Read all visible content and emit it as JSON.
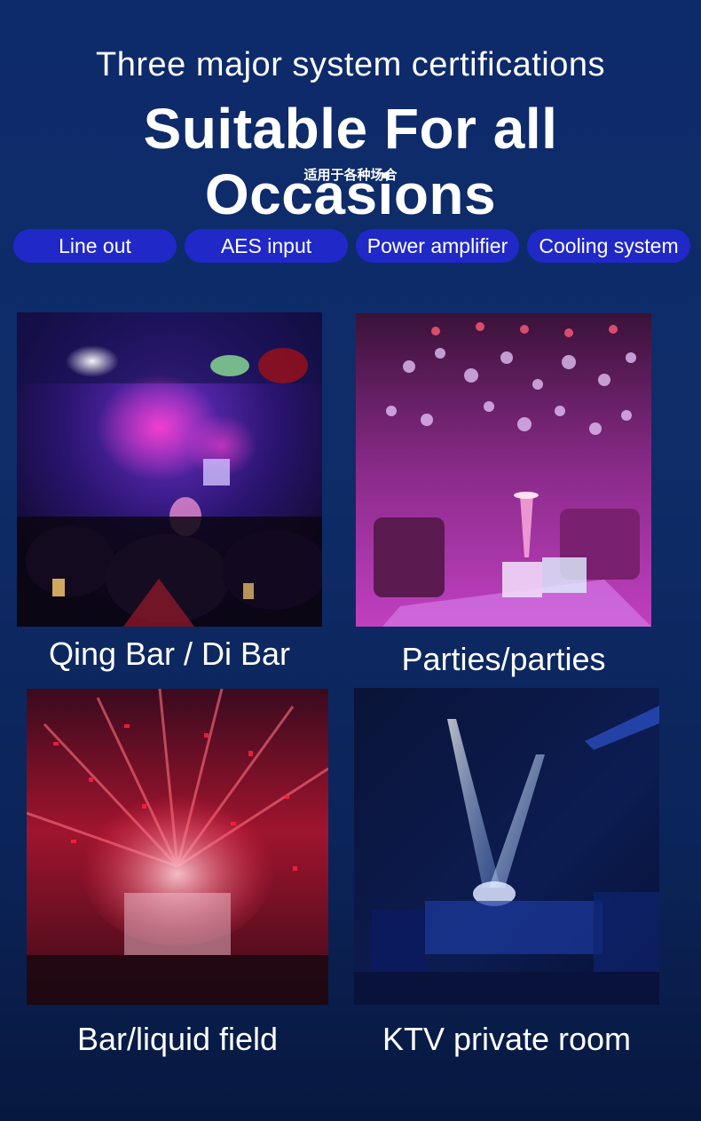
{
  "header": {
    "subtitle": "Three major system certifications",
    "title": "Suitable For all Occasions",
    "chinese_subtitle": "适用于各种场合"
  },
  "features": [
    {
      "label": "Line out"
    },
    {
      "label": "AES input"
    },
    {
      "label": "Power amplifier"
    },
    {
      "label": "Cooling system"
    }
  ],
  "scenes": [
    {
      "caption": "Qing Bar / Di Bar",
      "image": "nightclub-crowd-purple-lights"
    },
    {
      "caption": "Parties/parties",
      "image": "lounge-table-pink-bokeh"
    },
    {
      "caption": "Bar/liquid field",
      "image": "stage-confetti-red-beams"
    },
    {
      "caption": "KTV private room",
      "image": "ktv-room-blue-beams"
    }
  ],
  "colors": {
    "background_top": "#0d2a6b",
    "background_bottom": "#07183f",
    "pill": "#2028c8",
    "text": "#ffffff"
  }
}
